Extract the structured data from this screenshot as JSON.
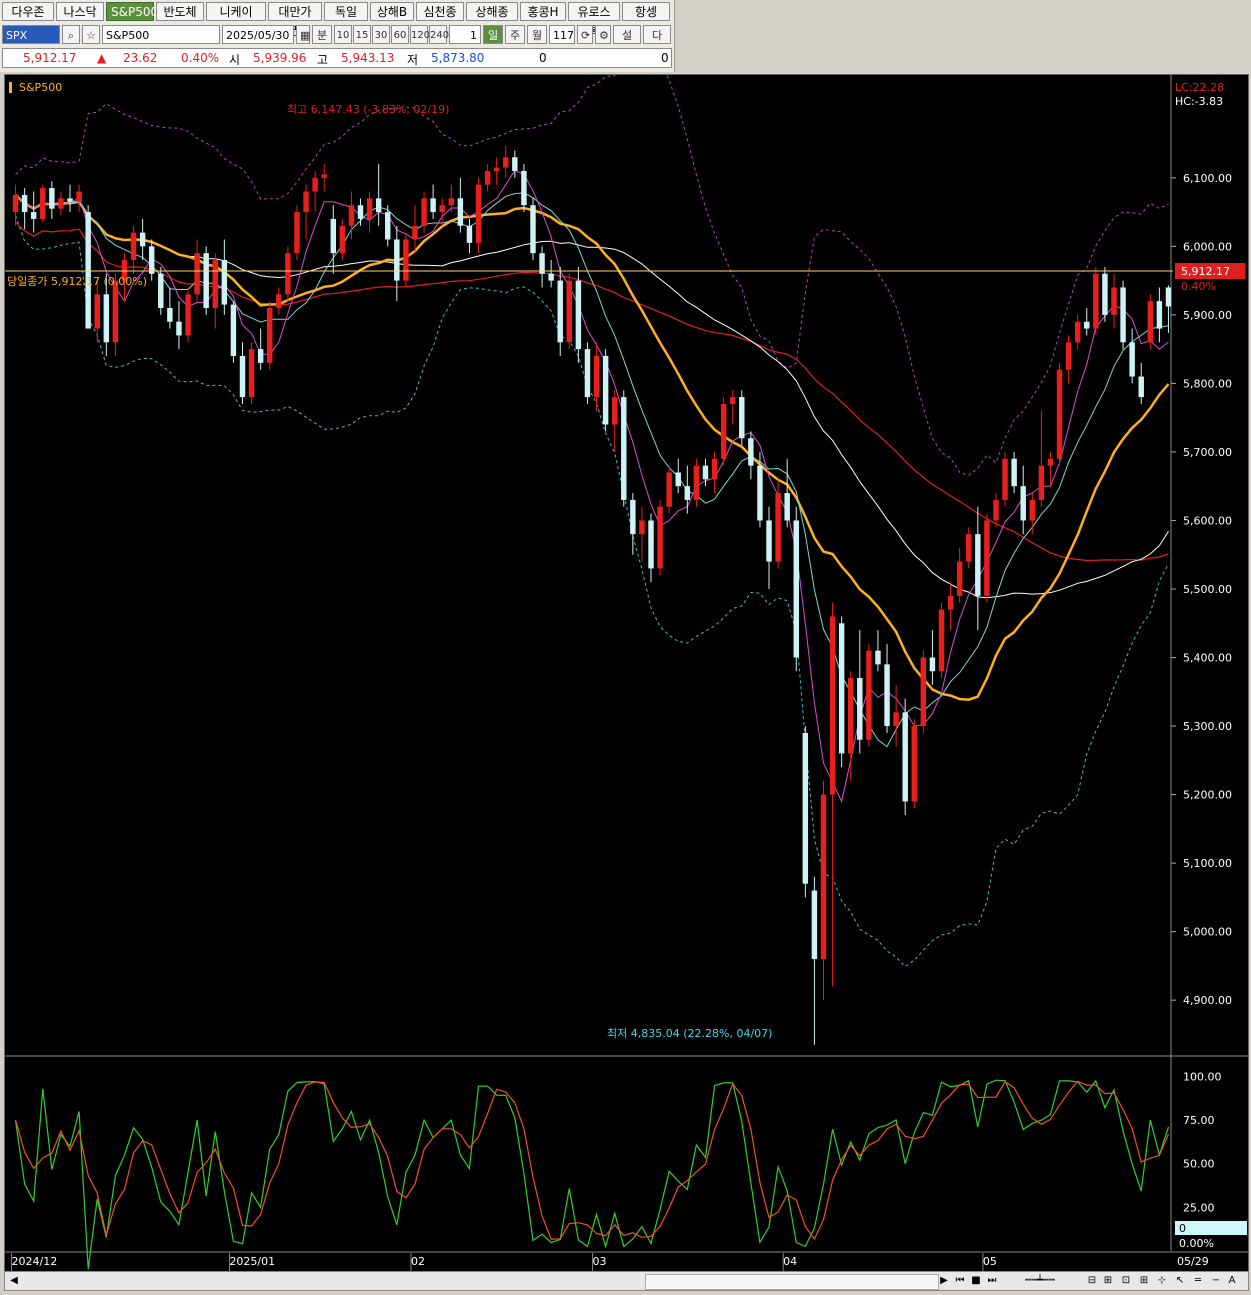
{
  "tabs": [
    "다우존스",
    "나스닥",
    "S&P500",
    "반도체",
    "니케이",
    "대만가권",
    "독일",
    "상해B",
    "심천종합",
    "상해종합",
    "홍콩H",
    "유로스톡",
    "항셍"
  ],
  "active_tab": 2,
  "controls": {
    "code": "SPX",
    "name": "S&P500",
    "date": "2025/05/30",
    "period_minute": "분",
    "minute_options": [
      "10",
      "15",
      "30",
      "60",
      "120",
      "240"
    ],
    "count": "1",
    "period_day": "일",
    "period_week": "주",
    "period_month": "월",
    "bars": "117",
    "settings": "설정",
    "next": "다음"
  },
  "quote": {
    "price": "5,912.17",
    "change_arrow": "▲",
    "change": "23.62",
    "change_pct": "0.40%",
    "open_label": "시",
    "open": "5,939.96",
    "high_label": "고",
    "high": "5,943.13",
    "low_label": "저",
    "low": "5,873.80",
    "volume": "0",
    "amount": "0"
  },
  "chart": {
    "legend": "S&P500",
    "lc_label": "LC:22.28",
    "hc_label": "HC:-3.83",
    "high_marker": "최고 6,147.43 (-3.83%, 02/19)",
    "low_marker": "최저 4,835.04 (22.28%, 04/07)",
    "close_line_label": "당일종가 5,912.17 (0.00%)",
    "price_tag": "5,912.17",
    "price_tag_pct": "0.40%",
    "y_ticks": [
      "6,100.00",
      "6,000.00",
      "5,900.00",
      "5,800.00",
      "5,700.00",
      "5,600.00",
      "5,500.00",
      "5,400.00",
      "5,300.00",
      "5,200.00",
      "5,100.00",
      "5,000.00",
      "4,900.00"
    ],
    "osc_ticks": [
      "100.00",
      "75.00",
      "50.00",
      "25.00"
    ],
    "osc_value": "0",
    "osc_pct": "0.00%",
    "x_labels": [
      "2024/12",
      "2025/01",
      "02",
      "03",
      "04",
      "05",
      "05/29"
    ],
    "colors": {
      "up": "#e8201c",
      "down": "#cdf3f7",
      "ma5": "#d94fd0",
      "ma10": "#7fd7d0",
      "ma20": "#ffb020",
      "ma60": "#ffffff",
      "ma120": "#e02020",
      "band": "#c040c0",
      "bandlow": "#40c0c0"
    }
  },
  "chart_data": {
    "type": "candlestick",
    "title": "S&P500",
    "ohlc": [
      {
        "o": 6050,
        "h": 6090,
        "l": 6030,
        "c": 6075
      },
      {
        "o": 6075,
        "h": 6085,
        "l": 6025,
        "c": 6050
      },
      {
        "o": 6050,
        "h": 6080,
        "l": 6020,
        "c": 6040
      },
      {
        "o": 6040,
        "h": 6090,
        "l": 6035,
        "c": 6085
      },
      {
        "o": 6085,
        "h": 6095,
        "l": 6040,
        "c": 6055
      },
      {
        "o": 6055,
        "h": 6080,
        "l": 6045,
        "c": 6070
      },
      {
        "o": 6070,
        "h": 6090,
        "l": 6050,
        "c": 6065
      },
      {
        "o": 6065,
        "h": 6090,
        "l": 6050,
        "c": 6080
      },
      {
        "o": 6050,
        "h": 6060,
        "l": 5900,
        "c": 5880
      },
      {
        "o": 5880,
        "h": 5950,
        "l": 5860,
        "c": 5930
      },
      {
        "o": 5930,
        "h": 5960,
        "l": 5840,
        "c": 5860
      },
      {
        "o": 5860,
        "h": 5960,
        "l": 5840,
        "c": 5950
      },
      {
        "o": 5950,
        "h": 5990,
        "l": 5920,
        "c": 5980
      },
      {
        "o": 5980,
        "h": 6030,
        "l": 5960,
        "c": 6020
      },
      {
        "o": 6020,
        "h": 6040,
        "l": 5980,
        "c": 6000
      },
      {
        "o": 6000,
        "h": 6010,
        "l": 5950,
        "c": 5960
      },
      {
        "o": 5960,
        "h": 5970,
        "l": 5900,
        "c": 5910
      },
      {
        "o": 5910,
        "h": 5940,
        "l": 5880,
        "c": 5890
      },
      {
        "o": 5890,
        "h": 5920,
        "l": 5850,
        "c": 5870
      },
      {
        "o": 5870,
        "h": 5940,
        "l": 5860,
        "c": 5930
      },
      {
        "o": 5930,
        "h": 6010,
        "l": 5920,
        "c": 5990
      },
      {
        "o": 5990,
        "h": 6000,
        "l": 5900,
        "c": 5910
      },
      {
        "o": 5910,
        "h": 5990,
        "l": 5880,
        "c": 5980
      },
      {
        "o": 5980,
        "h": 6010,
        "l": 5900,
        "c": 5915
      },
      {
        "o": 5915,
        "h": 5920,
        "l": 5830,
        "c": 5840
      },
      {
        "o": 5840,
        "h": 5860,
        "l": 5770,
        "c": 5780
      },
      {
        "o": 5780,
        "h": 5860,
        "l": 5770,
        "c": 5850
      },
      {
        "o": 5850,
        "h": 5880,
        "l": 5820,
        "c": 5830
      },
      {
        "o": 5830,
        "h": 5920,
        "l": 5820,
        "c": 5910
      },
      {
        "o": 5910,
        "h": 5940,
        "l": 5900,
        "c": 5930
      },
      {
        "o": 5930,
        "h": 6000,
        "l": 5920,
        "c": 5990
      },
      {
        "o": 5990,
        "h": 6060,
        "l": 5980,
        "c": 6050
      },
      {
        "o": 6050,
        "h": 6090,
        "l": 6010,
        "c": 6080
      },
      {
        "o": 6080,
        "h": 6110,
        "l": 6050,
        "c": 6100
      },
      {
        "o": 6100,
        "h": 6120,
        "l": 6080,
        "c": 6105
      },
      {
        "o": 6040,
        "h": 6060,
        "l": 5960,
        "c": 5990
      },
      {
        "o": 5990,
        "h": 6040,
        "l": 5980,
        "c": 6030
      },
      {
        "o": 6030,
        "h": 6080,
        "l": 6010,
        "c": 6060
      },
      {
        "o": 6060,
        "h": 6070,
        "l": 6030,
        "c": 6040
      },
      {
        "o": 6040,
        "h": 6080,
        "l": 6020,
        "c": 6070
      },
      {
        "o": 6070,
        "h": 6120,
        "l": 6030,
        "c": 6050
      },
      {
        "o": 6050,
        "h": 6060,
        "l": 6000,
        "c": 6010
      },
      {
        "o": 6010,
        "h": 6030,
        "l": 5920,
        "c": 5950
      },
      {
        "o": 5950,
        "h": 6020,
        "l": 5940,
        "c": 6010
      },
      {
        "o": 6010,
        "h": 6060,
        "l": 5990,
        "c": 6030
      },
      {
        "o": 6030,
        "h": 6080,
        "l": 6020,
        "c": 6070
      },
      {
        "o": 6070,
        "h": 6090,
        "l": 6040,
        "c": 6050
      },
      {
        "o": 6050,
        "h": 6070,
        "l": 6030,
        "c": 6060
      },
      {
        "o": 6060,
        "h": 6090,
        "l": 6050,
        "c": 6070
      },
      {
        "o": 6070,
        "h": 6100,
        "l": 6020,
        "c": 6030
      },
      {
        "o": 6030,
        "h": 6040,
        "l": 5990,
        "c": 6005
      },
      {
        "o": 6005,
        "h": 6100,
        "l": 5990,
        "c": 6090
      },
      {
        "o": 6090,
        "h": 6120,
        "l": 6080,
        "c": 6110
      },
      {
        "o": 6110,
        "h": 6130,
        "l": 6090,
        "c": 6115
      },
      {
        "o": 6115,
        "h": 6147,
        "l": 6100,
        "c": 6130
      },
      {
        "o": 6130,
        "h": 6140,
        "l": 6100,
        "c": 6110
      },
      {
        "o": 6110,
        "h": 6120,
        "l": 6050,
        "c": 6060
      },
      {
        "o": 6060,
        "h": 6070,
        "l": 5980,
        "c": 5990
      },
      {
        "o": 5990,
        "h": 6000,
        "l": 5940,
        "c": 5960
      },
      {
        "o": 5960,
        "h": 5980,
        "l": 5940,
        "c": 5950
      },
      {
        "o": 5950,
        "h": 5970,
        "l": 5840,
        "c": 5860
      },
      {
        "o": 5860,
        "h": 5960,
        "l": 5850,
        "c": 5950
      },
      {
        "o": 5950,
        "h": 5970,
        "l": 5830,
        "c": 5850
      },
      {
        "o": 5850,
        "h": 5860,
        "l": 5770,
        "c": 5780
      },
      {
        "o": 5780,
        "h": 5860,
        "l": 5760,
        "c": 5840
      },
      {
        "o": 5840,
        "h": 5850,
        "l": 5730,
        "c": 5740
      },
      {
        "o": 5740,
        "h": 5790,
        "l": 5700,
        "c": 5780
      },
      {
        "o": 5780,
        "h": 5790,
        "l": 5620,
        "c": 5630
      },
      {
        "o": 5630,
        "h": 5640,
        "l": 5550,
        "c": 5580
      },
      {
        "o": 5580,
        "h": 5620,
        "l": 5540,
        "c": 5600
      },
      {
        "o": 5600,
        "h": 5610,
        "l": 5510,
        "c": 5530
      },
      {
        "o": 5530,
        "h": 5630,
        "l": 5520,
        "c": 5620
      },
      {
        "o": 5620,
        "h": 5680,
        "l": 5610,
        "c": 5670
      },
      {
        "o": 5670,
        "h": 5690,
        "l": 5640,
        "c": 5650
      },
      {
        "o": 5650,
        "h": 5680,
        "l": 5610,
        "c": 5630
      },
      {
        "o": 5630,
        "h": 5690,
        "l": 5620,
        "c": 5680
      },
      {
        "o": 5680,
        "h": 5690,
        "l": 5650,
        "c": 5660
      },
      {
        "o": 5660,
        "h": 5700,
        "l": 5640,
        "c": 5690
      },
      {
        "o": 5690,
        "h": 5780,
        "l": 5680,
        "c": 5770
      },
      {
        "o": 5770,
        "h": 5790,
        "l": 5740,
        "c": 5780
      },
      {
        "o": 5780,
        "h": 5790,
        "l": 5710,
        "c": 5720
      },
      {
        "o": 5720,
        "h": 5730,
        "l": 5660,
        "c": 5680
      },
      {
        "o": 5680,
        "h": 5700,
        "l": 5590,
        "c": 5600
      },
      {
        "o": 5600,
        "h": 5620,
        "l": 5500,
        "c": 5540
      },
      {
        "o": 5540,
        "h": 5660,
        "l": 5530,
        "c": 5640
      },
      {
        "o": 5640,
        "h": 5690,
        "l": 5590,
        "c": 5600
      },
      {
        "o": 5600,
        "h": 5620,
        "l": 5380,
        "c": 5400
      },
      {
        "o": 5290,
        "h": 5300,
        "l": 5050,
        "c": 5070
      },
      {
        "o": 5060,
        "h": 5080,
        "l": 4835,
        "c": 4960
      },
      {
        "o": 4960,
        "h": 5220,
        "l": 4900,
        "c": 5200
      },
      {
        "o": 5200,
        "h": 5480,
        "l": 4920,
        "c": 5460
      },
      {
        "o": 5450,
        "h": 5460,
        "l": 5240,
        "c": 5260
      },
      {
        "o": 5260,
        "h": 5380,
        "l": 5220,
        "c": 5370
      },
      {
        "o": 5370,
        "h": 5440,
        "l": 5260,
        "c": 5280
      },
      {
        "o": 5280,
        "h": 5420,
        "l": 5270,
        "c": 5410
      },
      {
        "o": 5410,
        "h": 5440,
        "l": 5380,
        "c": 5390
      },
      {
        "o": 5390,
        "h": 5420,
        "l": 5290,
        "c": 5300
      },
      {
        "o": 5300,
        "h": 5360,
        "l": 5270,
        "c": 5320
      },
      {
        "o": 5320,
        "h": 5340,
        "l": 5170,
        "c": 5190
      },
      {
        "o": 5190,
        "h": 5310,
        "l": 5180,
        "c": 5300
      },
      {
        "o": 5300,
        "h": 5410,
        "l": 5290,
        "c": 5400
      },
      {
        "o": 5400,
        "h": 5440,
        "l": 5360,
        "c": 5380
      },
      {
        "o": 5380,
        "h": 5480,
        "l": 5370,
        "c": 5470
      },
      {
        "o": 5470,
        "h": 5510,
        "l": 5440,
        "c": 5490
      },
      {
        "o": 5490,
        "h": 5560,
        "l": 5480,
        "c": 5540
      },
      {
        "o": 5540,
        "h": 5590,
        "l": 5530,
        "c": 5580
      },
      {
        "o": 5580,
        "h": 5620,
        "l": 5440,
        "c": 5490
      },
      {
        "o": 5490,
        "h": 5610,
        "l": 5480,
        "c": 5600
      },
      {
        "o": 5600,
        "h": 5640,
        "l": 5590,
        "c": 5630
      },
      {
        "o": 5630,
        "h": 5700,
        "l": 5620,
        "c": 5690
      },
      {
        "o": 5690,
        "h": 5700,
        "l": 5640,
        "c": 5650
      },
      {
        "o": 5650,
        "h": 5680,
        "l": 5580,
        "c": 5600
      },
      {
        "o": 5600,
        "h": 5640,
        "l": 5580,
        "c": 5630
      },
      {
        "o": 5630,
        "h": 5760,
        "l": 5620,
        "c": 5680
      },
      {
        "o": 5680,
        "h": 5700,
        "l": 5650,
        "c": 5690
      },
      {
        "o": 5690,
        "h": 5830,
        "l": 5680,
        "c": 5820
      },
      {
        "o": 5820,
        "h": 5870,
        "l": 5800,
        "c": 5860
      },
      {
        "o": 5860,
        "h": 5900,
        "l": 5850,
        "c": 5890
      },
      {
        "o": 5890,
        "h": 5910,
        "l": 5870,
        "c": 5880
      },
      {
        "o": 5880,
        "h": 5970,
        "l": 5870,
        "c": 5960
      },
      {
        "o": 5960,
        "h": 5970,
        "l": 5890,
        "c": 5900
      },
      {
        "o": 5900,
        "h": 5960,
        "l": 5880,
        "c": 5940
      },
      {
        "o": 5940,
        "h": 5950,
        "l": 5850,
        "c": 5860
      },
      {
        "o": 5860,
        "h": 5880,
        "l": 5800,
        "c": 5810
      },
      {
        "o": 5810,
        "h": 5830,
        "l": 5770,
        "c": 5780
      },
      {
        "o": 5860,
        "h": 5930,
        "l": 5850,
        "c": 5920
      },
      {
        "o": 5920,
        "h": 5940,
        "l": 5860,
        "c": 5880
      },
      {
        "o": 5939.96,
        "h": 5943.13,
        "l": 5873.8,
        "c": 5912.17
      }
    ],
    "ylim": [
      4820,
      6250
    ],
    "osc_ylim": [
      0,
      110
    ]
  }
}
